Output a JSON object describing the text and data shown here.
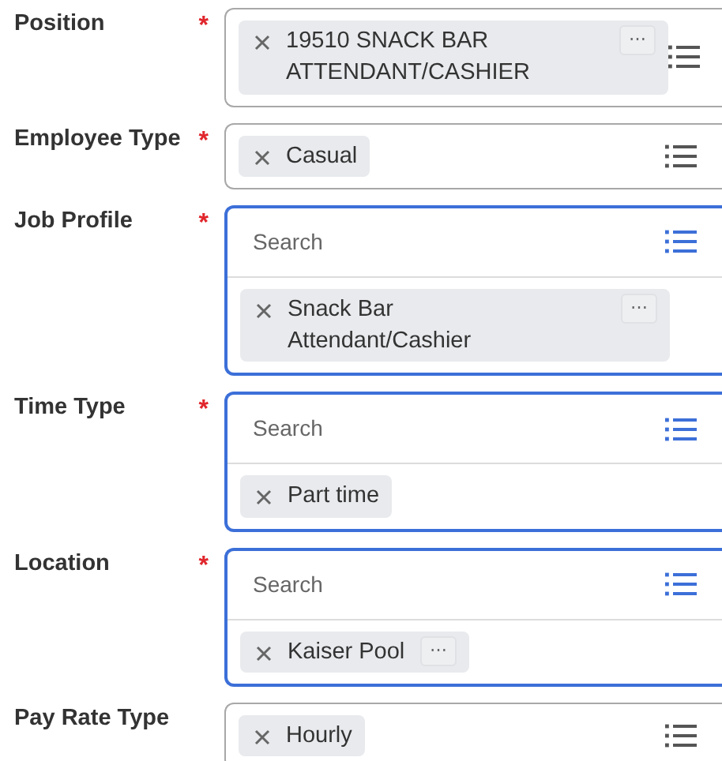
{
  "fields": [
    {
      "label": "Position",
      "required_mark": "*",
      "focused": false,
      "values": [
        {
          "text": "19510 SNACK BAR ATTENDANT/CASHIER",
          "more": "⋯"
        }
      ]
    },
    {
      "label": "Employee Type",
      "required_mark": "*",
      "focused": false,
      "values": [
        {
          "text": "Casual"
        }
      ]
    },
    {
      "label": "Job Profile",
      "required_mark": "*",
      "focused": true,
      "placeholder": "Search",
      "values": [
        {
          "text": "Snack Bar Attendant/Cashier",
          "more": "⋯"
        }
      ]
    },
    {
      "label": "Time Type",
      "required_mark": "*",
      "focused": true,
      "placeholder": "Search",
      "values": [
        {
          "text": "Part time"
        }
      ]
    },
    {
      "label": "Location",
      "required_mark": "*",
      "focused": true,
      "placeholder": "Search",
      "values": [
        {
          "text": "Kaiser Pool",
          "more": "⋯"
        }
      ]
    },
    {
      "label": "Pay Rate Type",
      "focused": false,
      "values": [
        {
          "text": "Hourly"
        }
      ]
    }
  ]
}
